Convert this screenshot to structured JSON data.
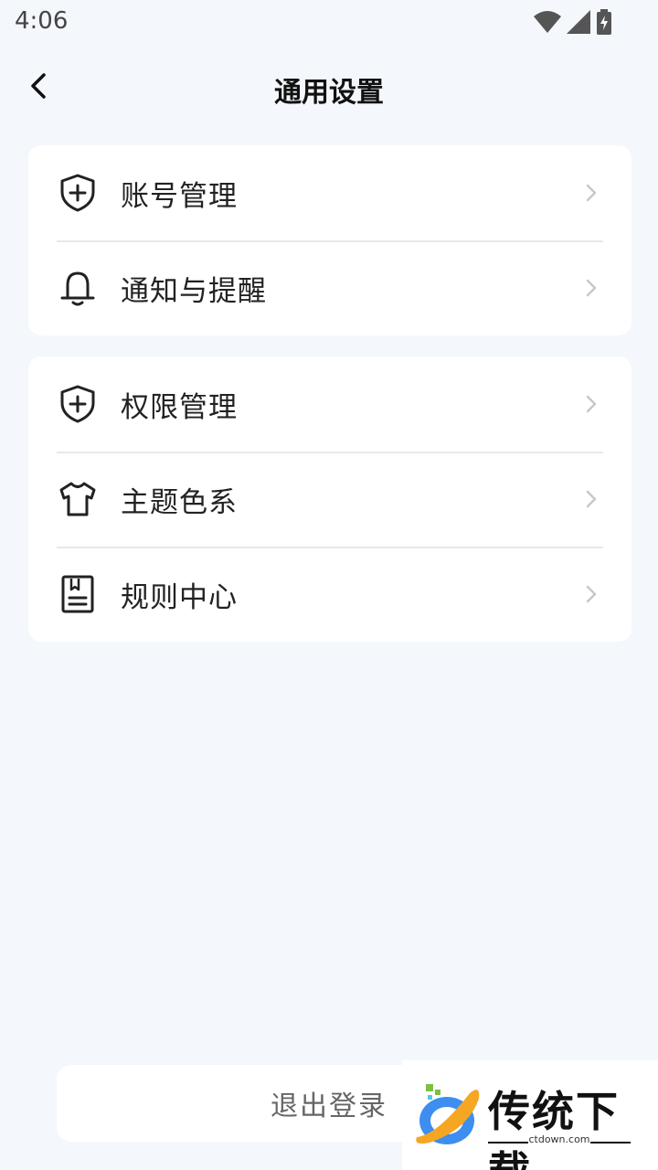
{
  "status_bar": {
    "time": "4:06"
  },
  "header": {
    "title": "通用设置"
  },
  "groups": [
    {
      "items": [
        {
          "label": "账号管理",
          "icon": "shield-plus-icon"
        },
        {
          "label": "通知与提醒",
          "icon": "bell-icon"
        }
      ]
    },
    {
      "items": [
        {
          "label": "权限管理",
          "icon": "shield-plus-icon"
        },
        {
          "label": "主题色系",
          "icon": "tshirt-icon"
        },
        {
          "label": "规则中心",
          "icon": "rulebook-icon"
        }
      ]
    }
  ],
  "logout": {
    "label": "退出登录"
  },
  "watermark": {
    "text": "传统下载",
    "domain": "ctdown.com"
  },
  "colors": {
    "background": "#f4f7fb",
    "card": "#ffffff",
    "text": "#222222",
    "muted": "#666666",
    "chevron": "#c8c8c8"
  }
}
